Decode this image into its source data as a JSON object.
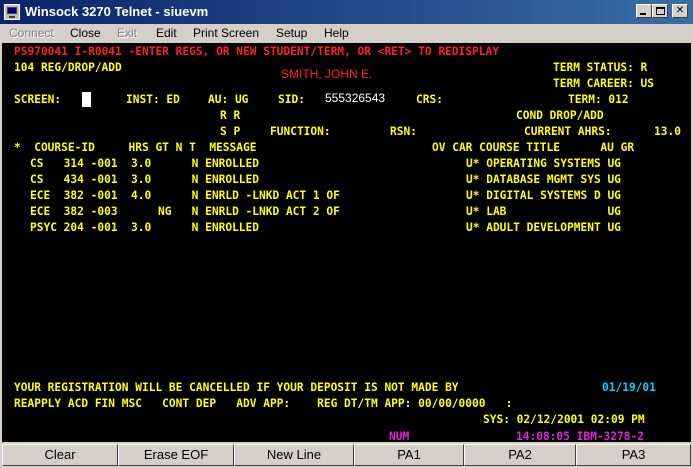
{
  "window": {
    "title": "Winsock 3270 Telnet - siuevm",
    "minimize_label": "_",
    "close_label": "✕"
  },
  "menu": [
    "Connect",
    "Close",
    "Exit",
    "Edit",
    "Print Screen",
    "Setup",
    "Help"
  ],
  "screen": {
    "message": "PS970041 I-R0041 -ENTER REGS, OR NEW STUDENT/TERM, OR <RET> TO REDISPLAY",
    "function_title": "104 REG/DROP/ADD",
    "term_status": "TERM STATUS: R",
    "student_name": "SMITH, JOHN E.",
    "term_career": "TERM CAREER: US",
    "screen_label": "SCREEN:",
    "inst": "INST: ED",
    "au": "AU: UG",
    "sid_label": "SID:",
    "sid": "555326543",
    "crs_label": "CRS:",
    "term": "TERM: 012",
    "rr": "R R",
    "cond": "COND DROP/ADD",
    "sp": "S P",
    "function_label": "FUNCTION:",
    "rsn_label": "RSN:",
    "current_ahrs": "CURRENT AHRS:",
    "ahrs_value": "13.0",
    "header_left": "*  COURSE-ID     HRS GT N T  MESSAGE",
    "header_right": "OV CAR COURSE TITLE      AU GR",
    "rows": [
      {
        "left": "CS   314 -001  3.0      N ENROLLED",
        "right": "U* OPERATING SYSTEMS UG"
      },
      {
        "left": "CS   434 -001  3.0      N ENROLLED",
        "right": "U* DATABASE MGMT SYS UG"
      },
      {
        "left": "ECE  382 -001  4.0      N ENRLD -LNKD ACT 1 OF",
        "right": "U* DIGITAL SYSTEMS D UG"
      },
      {
        "left": "ECE  382 -003      NG   N ENRLD -LNKD ACT 2 OF",
        "right": "U* LAB               UG"
      },
      {
        "left": "PSYC 204 -001  3.0      N ENROLLED",
        "right": "U* ADULT DEVELOPMENT UG"
      }
    ],
    "footer_notice": "YOUR REGISTRATION WILL BE CANCELLED IF YOUR DEPOSIT IS NOT MADE BY",
    "deposit_date": "01/19/01",
    "footer_line2": "REAPPLY ACD FIN MSC   CONT DEP   ADV APP:    REG DT/TM APP: 00/00/0000   :",
    "sys_line": "SYS: 02/12/2001 02:09 PM",
    "num_indicator": "NUM",
    "status_clock": "14:08:05 IBM-3278-2"
  },
  "pf_keys": [
    "Clear",
    "Erase EOF",
    "New Line",
    "PA1",
    "PA2",
    "PA3"
  ],
  "colors": {
    "text": "#ffff00",
    "message": "#ff2020",
    "date": "#00d0ff",
    "indicator": "#e020e0",
    "background": "#000000"
  }
}
